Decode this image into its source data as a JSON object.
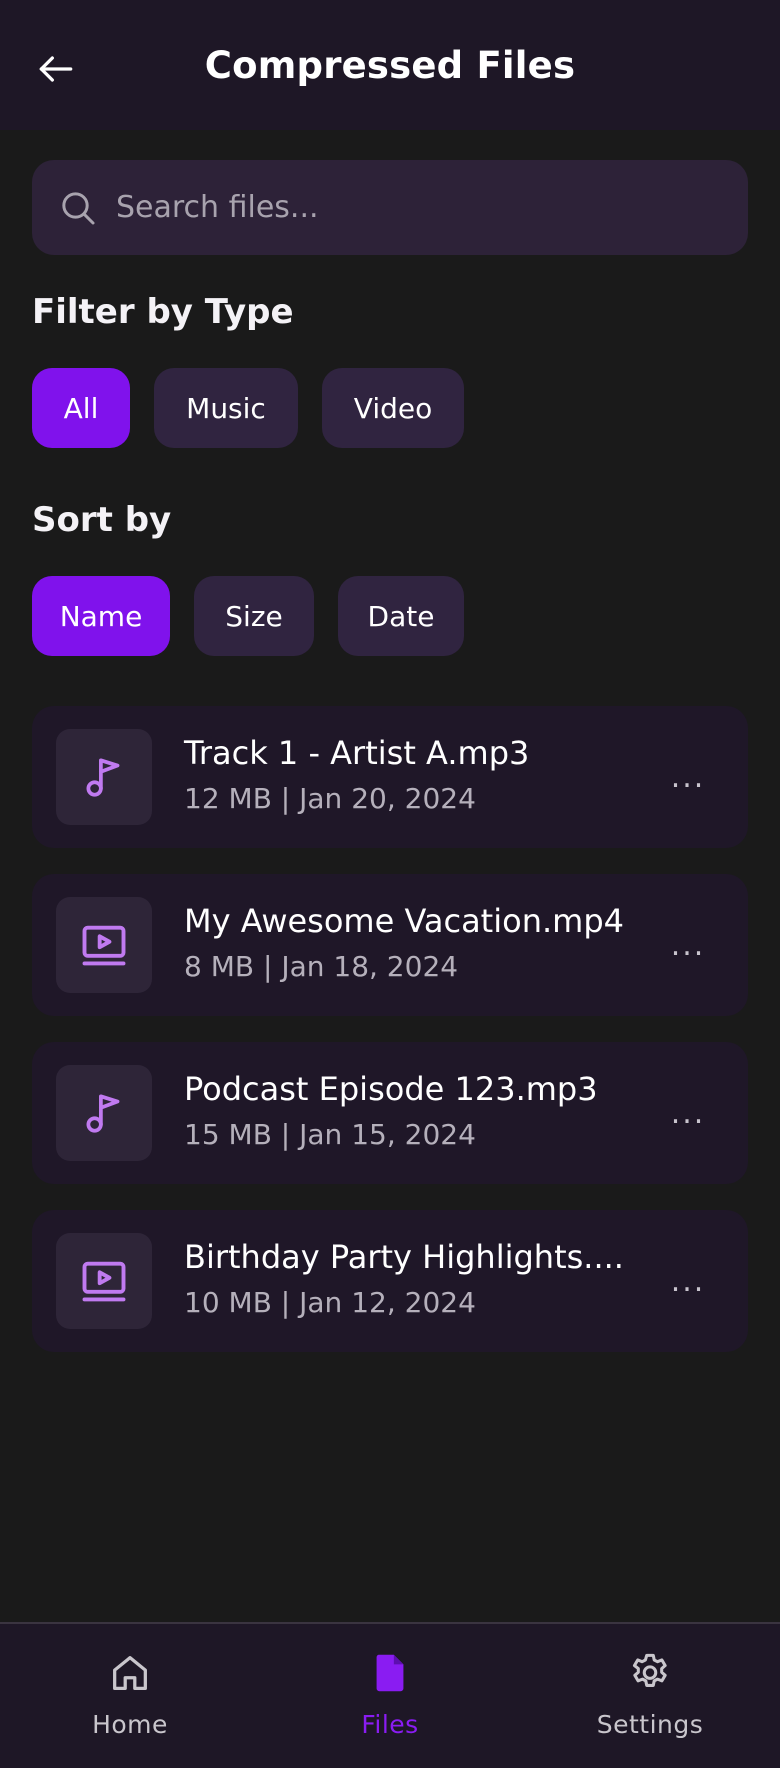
{
  "header": {
    "title": "Compressed Files"
  },
  "search": {
    "placeholder": "Search files..."
  },
  "filter": {
    "title": "Filter by Type",
    "chips": [
      "All",
      "Music",
      "Video"
    ],
    "active": "All"
  },
  "sort": {
    "title": "Sort by",
    "chips": [
      "Name",
      "Size",
      "Date"
    ],
    "active": "Name"
  },
  "files": [
    {
      "icon": "music-note-icon",
      "name": "Track 1 - Artist A.mp3",
      "meta": "12 MB | Jan 20, 2024"
    },
    {
      "icon": "video-icon",
      "name": "My Awesome Vacation.mp4",
      "meta": "8 MB | Jan 18, 2024"
    },
    {
      "icon": "music-note-icon",
      "name": "Podcast Episode 123.mp3",
      "meta": "15 MB | Jan 15, 2024"
    },
    {
      "icon": "video-icon",
      "name": "Birthday Party Highlights....",
      "meta": "10 MB | Jan 12, 2024"
    }
  ],
  "more_label": "...",
  "nav": {
    "items": [
      {
        "icon": "home-icon",
        "label": "Home"
      },
      {
        "icon": "file-icon",
        "label": "Files"
      },
      {
        "icon": "gear-icon",
        "label": "Settings"
      }
    ],
    "active": "Files"
  },
  "colors": {
    "accent": "#8012ec",
    "background": "#1a1a1a",
    "surface": "#1e1726",
    "chip": "#302440",
    "icon_accent": "#c07af0"
  }
}
